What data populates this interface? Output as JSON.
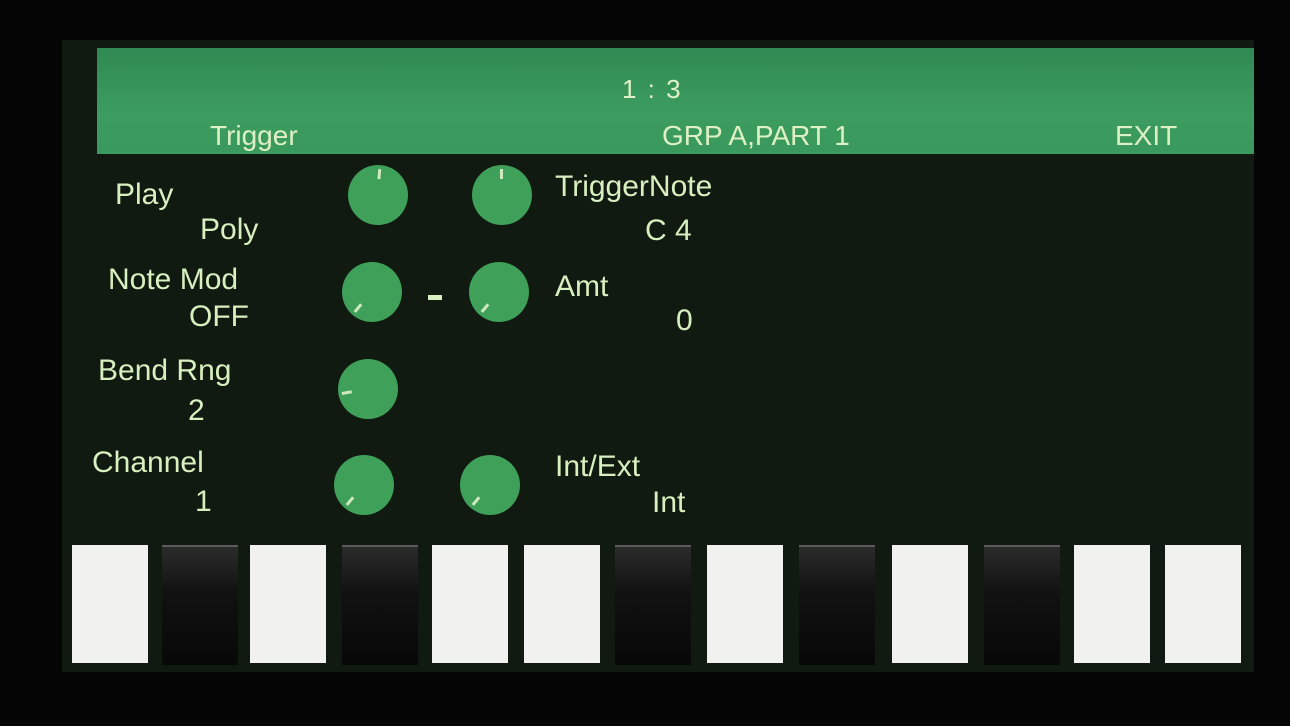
{
  "header": {
    "page": "1 : 3",
    "left_label": "Trigger",
    "center_label": "GRP A,PART 1",
    "right_label": "EXIT"
  },
  "params": [
    {
      "name": "Play",
      "value": "Poly"
    },
    {
      "name": "Note Mod",
      "value": "OFF"
    },
    {
      "name": "Bend Rng",
      "value": "2"
    },
    {
      "name": "Channel",
      "value": "1"
    }
  ],
  "right_params": [
    {
      "name": "TriggerNote",
      "value": "C 4"
    },
    {
      "name": "Amt",
      "value": "0"
    },
    {
      "name": "Int/Ext",
      "value": "Int"
    }
  ],
  "keys": [
    "white",
    "black",
    "white",
    "black",
    "white",
    "white",
    "black",
    "white",
    "black",
    "white",
    "black",
    "white",
    "white"
  ],
  "colors": {
    "accent": "#3a9a5e",
    "text": "#d8efbf",
    "background": "#101a10",
    "knob": "#3fa059"
  }
}
